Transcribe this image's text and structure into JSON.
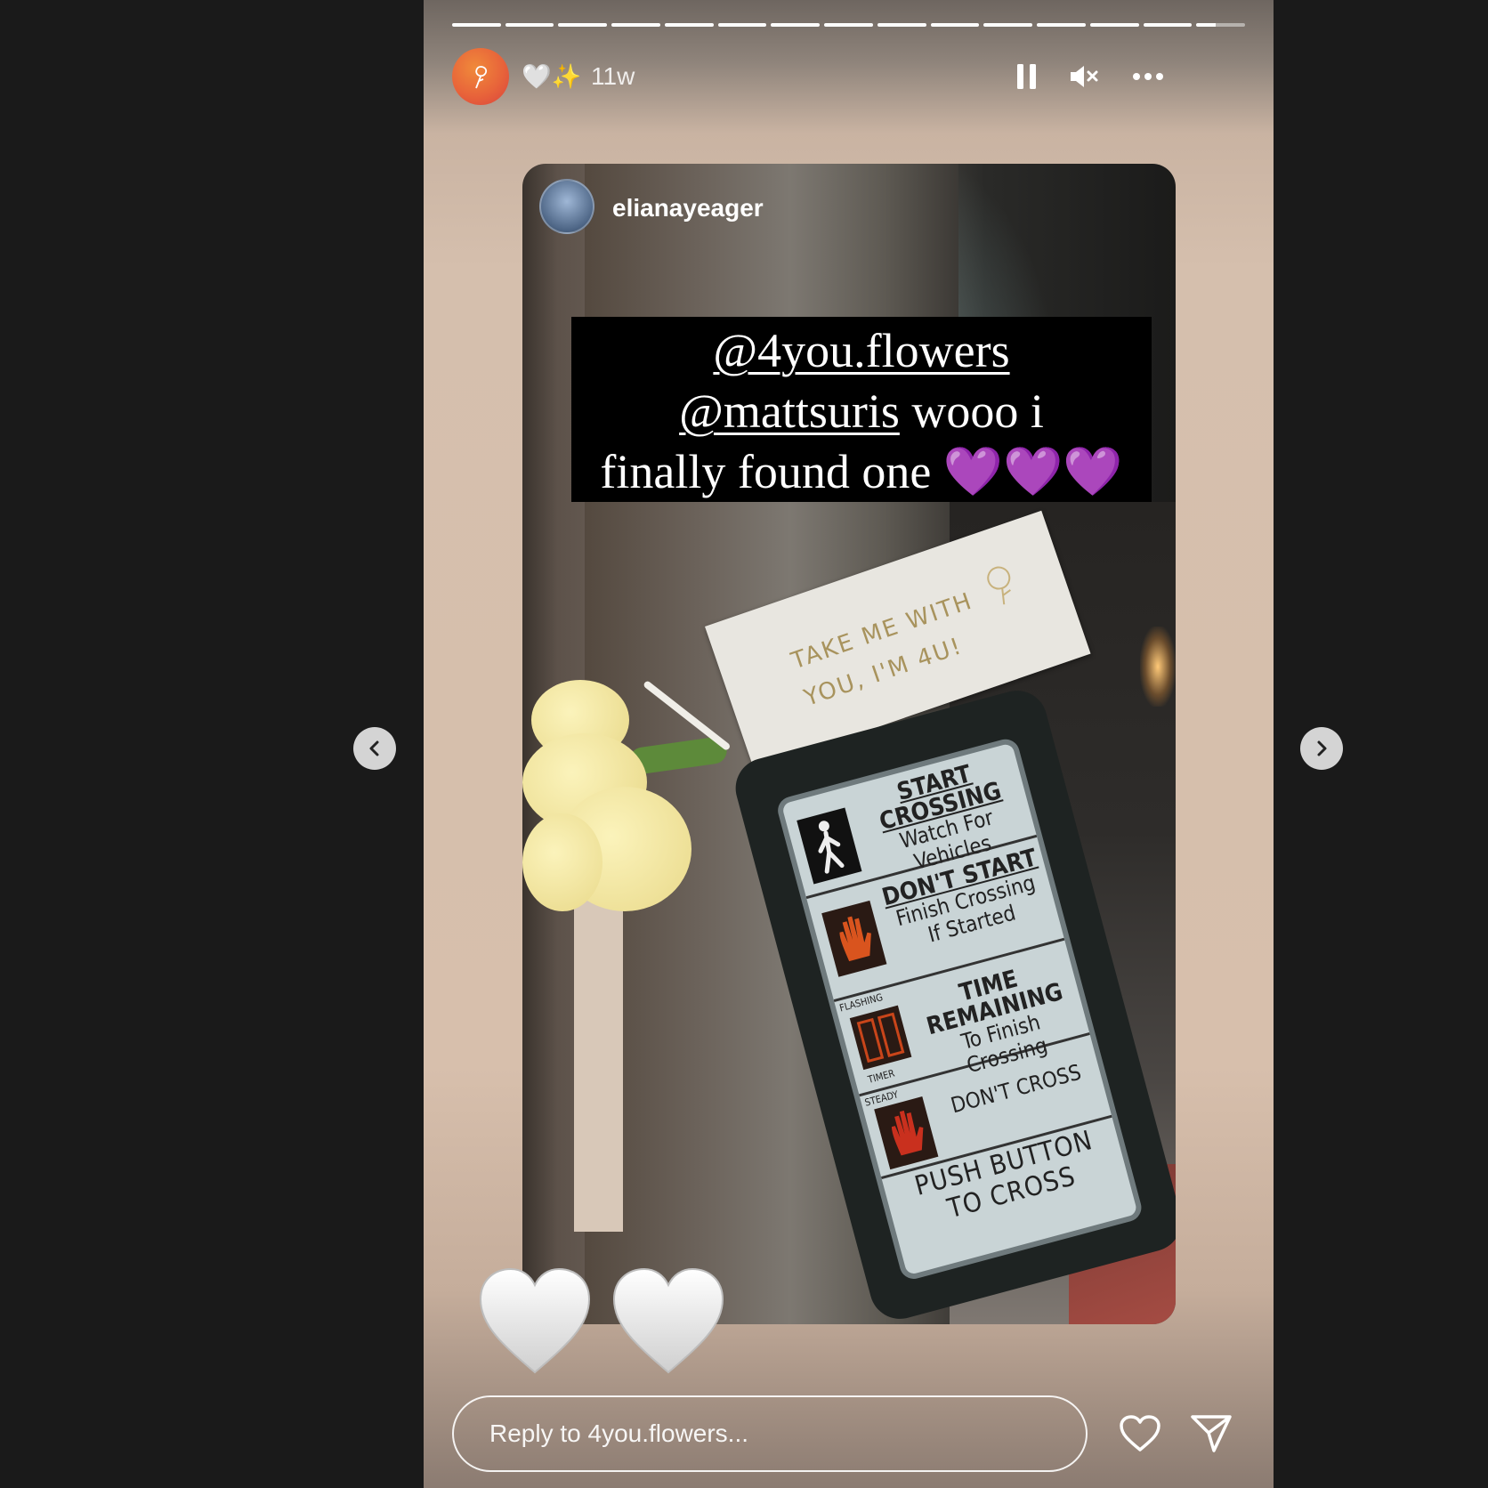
{
  "story": {
    "progress_segments": 15,
    "progress_completed": 14.4,
    "header": {
      "emoji": "🤍✨",
      "time_ago": "11w"
    },
    "controls": {
      "pause_icon": "pause-icon",
      "mute_icon": "speaker-muted-icon",
      "more_icon": "more-horizontal-icon"
    },
    "shared_post": {
      "username": "elianayeager",
      "caption_mention_1": "@4you.flowers",
      "caption_mention_2": "@mattsuris",
      "caption_text_1": " wooo i",
      "caption_text_2": "finally found one ",
      "caption_hearts": "💜💜💜",
      "tag_line_1": "TAKE ME WITH",
      "tag_line_2": "YOU, I'M 4U!",
      "crossing_sign": {
        "row1_title": "START CROSSING",
        "row1_text": "Watch For Vehicles",
        "row2_title": "DON'T START",
        "row2_text": "Finish Crossing If Started",
        "row3_title": "TIME REMAINING",
        "row3_text": "To Finish Crossing",
        "row3_labels_1": "FLASHING",
        "row3_labels_2": "TIMER",
        "row4_text": "DON'T CROSS",
        "row4_label": "STEADY",
        "push_text": "PUSH BUTTON TO CROSS"
      }
    },
    "stickers": [
      "🤍",
      "🤍"
    ],
    "reply": {
      "placeholder": "Reply to 4you.flowers..."
    },
    "actions": {
      "like_icon": "heart-outline-icon",
      "share_icon": "paper-plane-icon"
    }
  },
  "navigation": {
    "prev_icon": "chevron-left-icon",
    "next_icon": "chevron-right-icon"
  },
  "colors": {
    "page_background": "#1a1a1a",
    "story_tint": "#d7bfac",
    "caption_background": "#000000"
  }
}
